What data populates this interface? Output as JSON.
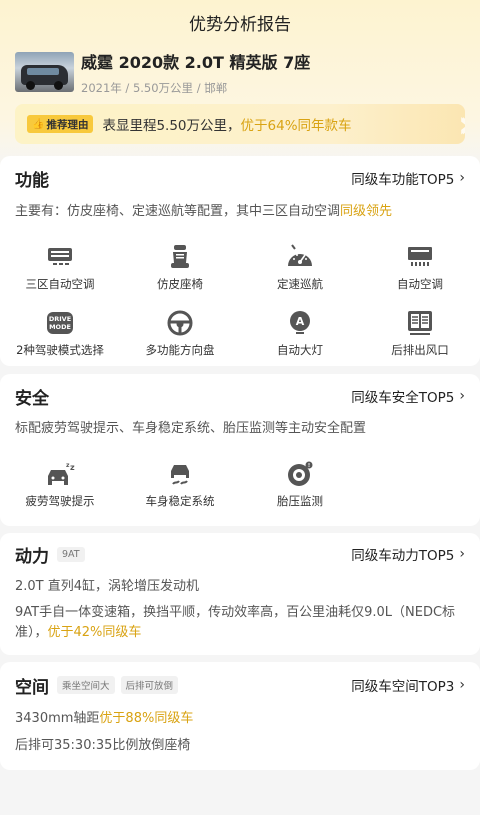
{
  "header": {
    "title": "优势分析报告"
  },
  "car": {
    "name": "威霆 2020款 2.0T 精英版 7座",
    "meta": "2021年 / 5.50万公里 / 邯郸"
  },
  "reason": {
    "tag": "推荐理由",
    "text_plain": "表显里程5.50万公里，",
    "text_highlight": "优于64%同年款车"
  },
  "function": {
    "title": "功能",
    "link": "同级车功能TOP5",
    "desc_plain": "主要有：仿皮座椅、定速巡航等配置，其中三区自动空调",
    "desc_highlight": "同级领先",
    "items": [
      {
        "label": "三区自动空调",
        "icon": "ac-vent-icon"
      },
      {
        "label": "仿皮座椅",
        "icon": "seat-icon"
      },
      {
        "label": "定速巡航",
        "icon": "speedometer-icon"
      },
      {
        "label": "自动空调",
        "icon": "ac-panel-icon"
      },
      {
        "label": "2种驾驶模式选择",
        "icon": "drive-mode-icon",
        "icon_text": "DRIVE MODE"
      },
      {
        "label": "多功能方向盘",
        "icon": "steering-wheel-icon"
      },
      {
        "label": "自动大灯",
        "icon": "headlight-icon",
        "icon_text": "A"
      },
      {
        "label": "后排出风口",
        "icon": "rear-vent-icon"
      }
    ]
  },
  "safety": {
    "title": "安全",
    "link": "同级车安全TOP5",
    "desc": "标配疲劳驾驶提示、车身稳定系统、胎压监测等主动安全配置",
    "items": [
      {
        "label": "疲劳驾驶提示",
        "icon": "fatigue-car-icon"
      },
      {
        "label": "车身稳定系统",
        "icon": "stability-icon"
      },
      {
        "label": "胎压监测",
        "icon": "tire-icon"
      }
    ]
  },
  "power": {
    "title": "动力",
    "badge": "9AT",
    "link": "同级车动力TOP5",
    "line1": "2.0T 直列4缸，涡轮增压发动机",
    "line2_plain": "9AT手自一体变速箱，换挡平顺，传动效率高，百公里油耗仅9.0L（NEDC标准），",
    "line2_highlight": "优于42%同级车"
  },
  "space": {
    "title": "空间",
    "badge1": "乘坐空间大",
    "badge2": "后排可放倒",
    "link": "同级车空间TOP3",
    "line1_plain": "3430mm轴距",
    "line1_highlight": "优于88%同级车",
    "line2": "后排可35:30:35比例放倒座椅"
  },
  "colors": {
    "highlight": "#d9a313",
    "tag": "#f8c93c"
  }
}
